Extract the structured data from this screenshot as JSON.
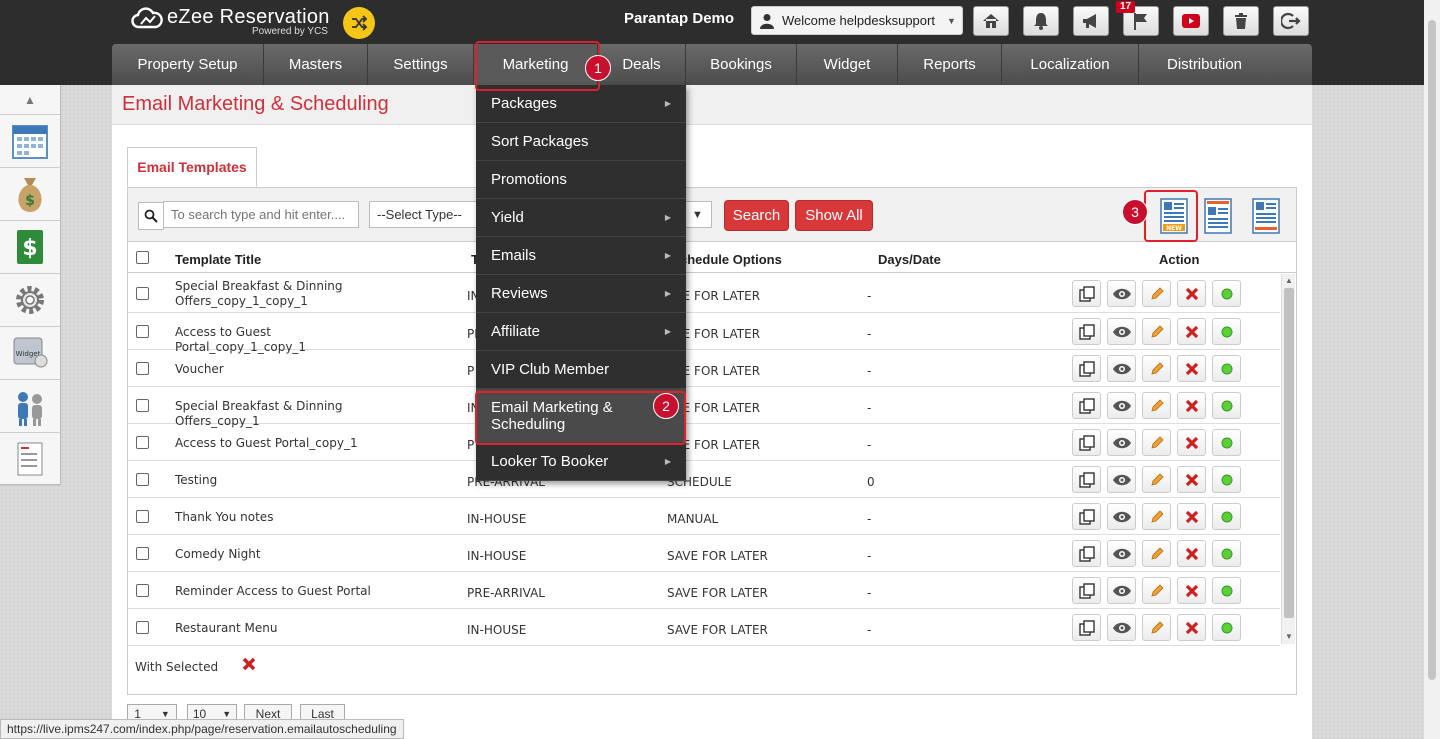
{
  "header": {
    "app_name": "eZee Reservation",
    "powered_by": "Powered by YCS",
    "property_name": "Parantap Demo",
    "welcome_text": "Welcome helpdesksupport",
    "notification_count": "17"
  },
  "nav": {
    "items": [
      "Property Setup",
      "Masters",
      "Settings",
      "Marketing",
      "Deals",
      "Bookings",
      "Widget",
      "Reports",
      "Localization",
      "Distribution"
    ],
    "active": "Marketing"
  },
  "markers": [
    "1",
    "2",
    "3"
  ],
  "marketing_menu": {
    "items": [
      {
        "label": "Packages",
        "has_submenu": true
      },
      {
        "label": "Sort Packages",
        "has_submenu": false
      },
      {
        "label": "Promotions",
        "has_submenu": false
      },
      {
        "label": "Yield",
        "has_submenu": true
      },
      {
        "label": "Emails",
        "has_submenu": true
      },
      {
        "label": "Reviews",
        "has_submenu": true
      },
      {
        "label": "Affiliate",
        "has_submenu": true
      },
      {
        "label": "VIP Club Member",
        "has_submenu": false
      },
      {
        "label": "Email Marketing & Scheduling",
        "has_submenu": false
      },
      {
        "label": "Looker To Booker",
        "has_submenu": true
      }
    ]
  },
  "page": {
    "title": "Email Marketing & Scheduling",
    "tab": "Email Templates"
  },
  "toolbar": {
    "search_placeholder": "To search type and hit enter....",
    "type_select": "--Select Type--",
    "search_button": "Search",
    "show_all_button": "Show All"
  },
  "table": {
    "columns": [
      "Template Title",
      "T",
      "chedule Options",
      "Days/Date",
      "Action"
    ],
    "rows": [
      {
        "title": "Special Breakfast & Dinning Offers_copy_1_copy_1",
        "type": "IN",
        "schedule": "AVE FOR LATER",
        "days": "-"
      },
      {
        "title": "Access to Guest Portal_copy_1_copy_1",
        "type": "PR",
        "schedule": "AVE FOR LATER",
        "days": "-"
      },
      {
        "title": "Voucher",
        "type": "P",
        "schedule": "AVE FOR LATER",
        "days": "-"
      },
      {
        "title": "Special Breakfast & Dinning Offers_copy_1",
        "type": "IN",
        "schedule": "AVE FOR LATER",
        "days": "-"
      },
      {
        "title": "Access to Guest Portal_copy_1",
        "type": "P",
        "schedule": "AVE FOR LATER",
        "days": "-"
      },
      {
        "title": "Testing",
        "type": "PRE-ARRIVAL",
        "schedule": "SCHEDULE",
        "days": "0"
      },
      {
        "title": "Thank You notes",
        "type": "IN-HOUSE",
        "schedule": "MANUAL",
        "days": "-"
      },
      {
        "title": "Comedy Night",
        "type": "IN-HOUSE",
        "schedule": "SAVE FOR LATER",
        "days": "-"
      },
      {
        "title": "Reminder Access to Guest Portal",
        "type": "PRE-ARRIVAL",
        "schedule": "SAVE FOR LATER",
        "days": "-"
      },
      {
        "title": "Restaurant Menu",
        "type": "IN-HOUSE",
        "schedule": "SAVE FOR LATER",
        "days": "-"
      }
    ]
  },
  "footer": {
    "with_selected": "With Selected",
    "page_select": "1",
    "per_page_select": "10",
    "next": "Next",
    "last": "Last"
  },
  "status_url": "https://live.ipms247.com/index.php/page/reservation.emailautoscheduling",
  "colors": {
    "accent_red": "#d0303a",
    "topbar": "#2d2d2d",
    "menu_bg": "#2f2f2f",
    "marker": "#c8102e"
  }
}
